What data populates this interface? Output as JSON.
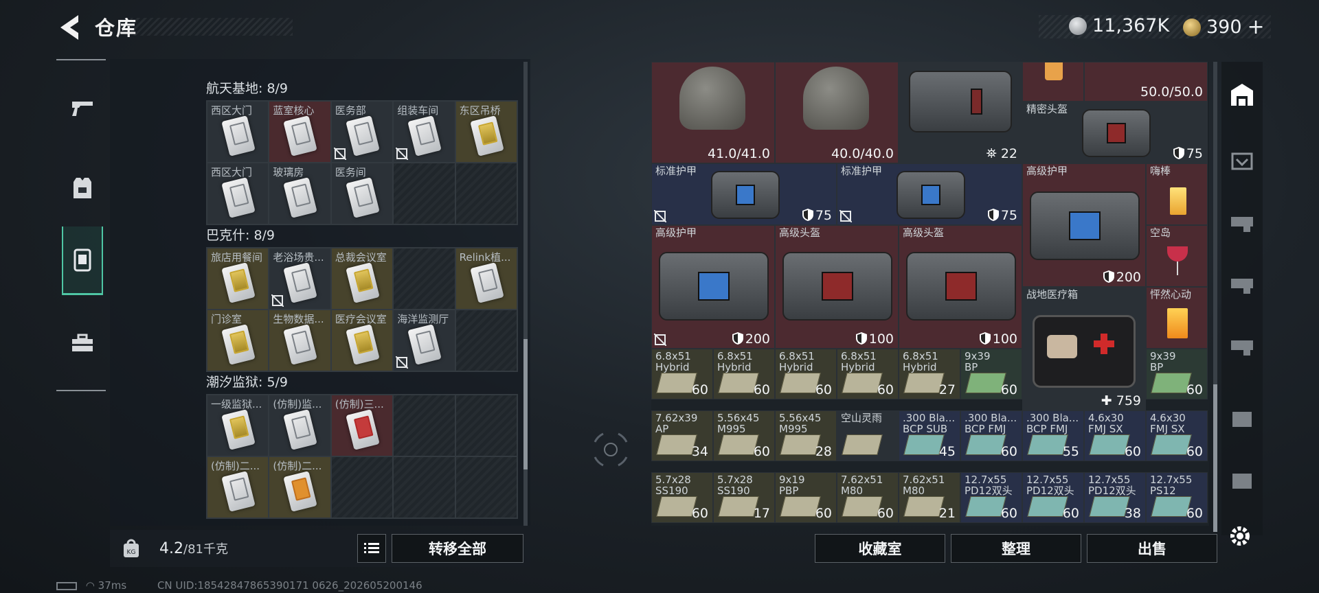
{
  "header": {
    "title": "仓库",
    "currency1": "11,367K",
    "currency2": "390",
    "add_label": "+"
  },
  "left": {
    "sections": [
      {
        "title": "航天基地: 8/9",
        "cells": [
          {
            "label": "西区大门",
            "tone": "",
            "card": "",
            "noicon": false
          },
          {
            "label": "蓝室核心",
            "tone": "red",
            "card": "",
            "noicon": false
          },
          {
            "label": "医务部",
            "tone": "",
            "card": "",
            "noicon": true
          },
          {
            "label": "组装车间",
            "tone": "",
            "card": "",
            "noicon": true
          },
          {
            "label": "东区吊桥",
            "tone": "yel",
            "card": "yc",
            "noicon": false
          },
          {
            "label": "西区大门",
            "tone": "",
            "card": "",
            "noicon": false
          },
          {
            "label": "玻璃房",
            "tone": "",
            "card": "",
            "noicon": false
          },
          {
            "label": "医务间",
            "tone": "",
            "card": "",
            "noicon": false
          },
          {
            "label": "",
            "tone": "empty",
            "card": "none",
            "noicon": false
          },
          {
            "label": "",
            "tone": "empty",
            "card": "none",
            "noicon": false
          }
        ]
      },
      {
        "title": "巴克什: 8/9",
        "cells": [
          {
            "label": "旅店用餐间",
            "tone": "yel",
            "card": "yc",
            "noicon": false
          },
          {
            "label": "老浴场贵...",
            "tone": "",
            "card": "",
            "noicon": true
          },
          {
            "label": "总裁会议室",
            "tone": "yel",
            "card": "yc",
            "noicon": false
          },
          {
            "label": "",
            "tone": "empty",
            "card": "none",
            "noicon": false
          },
          {
            "label": "Relink植...",
            "tone": "yel",
            "card": "",
            "noicon": false
          },
          {
            "label": "门诊室",
            "tone": "yel",
            "card": "yc",
            "noicon": false
          },
          {
            "label": "生物数据...",
            "tone": "yel",
            "card": "",
            "noicon": false
          },
          {
            "label": "医疗会议室",
            "tone": "yel",
            "card": "yc",
            "noicon": false
          },
          {
            "label": "海洋监测厅",
            "tone": "",
            "card": "",
            "noicon": true
          },
          {
            "label": "",
            "tone": "empty",
            "card": "none",
            "noicon": false
          }
        ]
      },
      {
        "title": "潮汐监狱: 5/9",
        "cells": [
          {
            "label": "一级监狱...",
            "tone": "",
            "card": "yc",
            "noicon": false
          },
          {
            "label": "(仿制)监...",
            "tone": "",
            "card": "",
            "noicon": false
          },
          {
            "label": "(仿制)三...",
            "tone": "red",
            "card": "rc",
            "noicon": false
          },
          {
            "label": "",
            "tone": "empty",
            "card": "none",
            "noicon": false
          },
          {
            "label": "",
            "tone": "empty",
            "card": "none",
            "noicon": false
          },
          {
            "label": "(仿制)二...",
            "tone": "yel",
            "card": "",
            "noicon": false
          },
          {
            "label": "(仿制)二...",
            "tone": "yel",
            "card": "oc",
            "noicon": false
          },
          {
            "label": "",
            "tone": "empty",
            "card": "none",
            "noicon": false
          },
          {
            "label": "",
            "tone": "empty",
            "card": "none",
            "noicon": false
          },
          {
            "label": "",
            "tone": "empty",
            "card": "none",
            "noicon": false
          }
        ]
      }
    ],
    "weight_value": "4.2",
    "weight_max": "/81千克",
    "transfer_all": "转移全部"
  },
  "right": {
    "row0": {
      "top_value": "50.0/50.0",
      "helmet1": "41.0/41.0",
      "helmet2": "40.0/40.0",
      "bag_count": "22",
      "precise_helmet": "精密头盔",
      "precise_val": "75"
    },
    "row1": [
      {
        "name": "标准护甲",
        "val": "75"
      },
      {
        "name": "标准护甲",
        "val": "75"
      }
    ],
    "adv_armor_big": {
      "name": "高级护甲",
      "val": "200"
    },
    "hibang": "嗨棒",
    "kongdao": "空岛",
    "row2": [
      {
        "name": "高级护甲",
        "val": "200"
      },
      {
        "name": "高级头盔",
        "val": "100"
      },
      {
        "name": "高级头盔",
        "val": "100"
      }
    ],
    "medkit": {
      "name": "战地医疗箱",
      "val": "759"
    },
    "pengran": "怦然心动",
    "ammo_row1": [
      {
        "name": "6.8x51\nHybrid",
        "val": "60"
      },
      {
        "name": "6.8x51\nHybrid",
        "val": "60"
      },
      {
        "name": "6.8x51\nHybrid",
        "val": "60"
      },
      {
        "name": "6.8x51\nHybrid",
        "val": "60"
      },
      {
        "name": "6.8x51\nHybrid",
        "val": "27"
      },
      {
        "name": "9x39\nBP",
        "val": "60"
      },
      {
        "name": "9x39\nBP",
        "val": "60"
      }
    ],
    "ammo_row2": [
      {
        "name": "7.62x39\nAP",
        "val": "34"
      },
      {
        "name": "5.56x45\nM995",
        "val": "60"
      },
      {
        "name": "5.56x45\nM995",
        "val": "28"
      },
      {
        "name": "空山灵雨",
        "val": ""
      },
      {
        "name": ".300 Bla...\nBCP SUB",
        "val": "45"
      },
      {
        "name": ".300 Bla...\nBCP FMJ",
        "val": "60"
      },
      {
        "name": ".300 Bla...\nBCP FMJ",
        "val": "55"
      },
      {
        "name": "4.6x30\nFMJ SX",
        "val": "60"
      },
      {
        "name": "4.6x30\nFMJ SX",
        "val": "60"
      }
    ],
    "ammo_row3": [
      {
        "name": "5.7x28\nSS190",
        "val": "60"
      },
      {
        "name": "5.7x28\nSS190",
        "val": "17"
      },
      {
        "name": "9x19\nPBP",
        "val": "60"
      },
      {
        "name": "7.62x51\nM80",
        "val": "60"
      },
      {
        "name": "7.62x51\nM80",
        "val": "21"
      },
      {
        "name": "12.7x55\nPD12双头",
        "val": "60"
      },
      {
        "name": "12.7x55\nPD12双头",
        "val": "60"
      },
      {
        "name": "12.7x55\nPD12双头",
        "val": "38"
      },
      {
        "name": "12.7x55\nPS12",
        "val": "60"
      }
    ],
    "buttons": {
      "collection": "收藏室",
      "arrange": "整理",
      "sell": "出售"
    }
  },
  "status": {
    "ping": "37ms",
    "uid": "CN UID:18542847865390171 0626_202605200146"
  }
}
